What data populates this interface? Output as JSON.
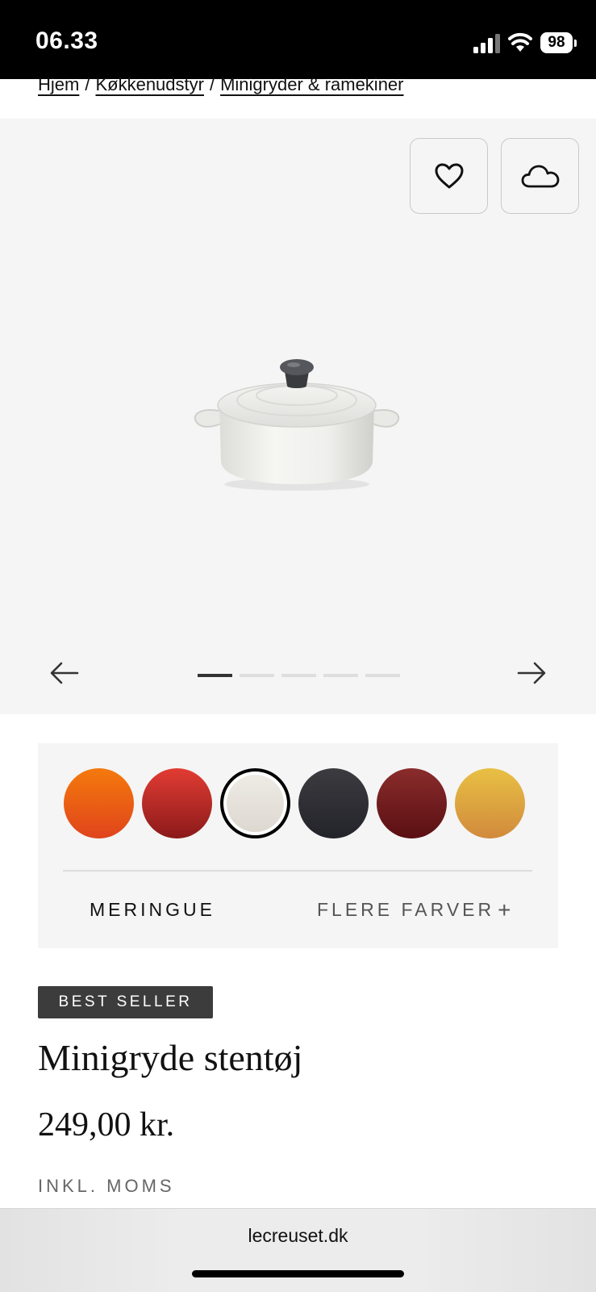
{
  "status": {
    "time": "06.33",
    "battery": "98"
  },
  "breadcrumb": {
    "items": [
      "Hjem",
      "Køkkenudstyr",
      "Minigryder & ramekiner"
    ],
    "separator": "/"
  },
  "gallery": {
    "slide_count": 5,
    "active_slide": 1
  },
  "colors": {
    "swatches": [
      {
        "name": "orange-swatch",
        "top": "#f47a0c",
        "bottom": "#e0441c"
      },
      {
        "name": "red-swatch",
        "top": "#e23c33",
        "bottom": "#8b1a1a"
      },
      {
        "name": "meringue-swatch",
        "top": "#efece6",
        "bottom": "#dcd7cf",
        "selected": true
      },
      {
        "name": "black-swatch",
        "top": "#3b3b40",
        "bottom": "#23232a"
      },
      {
        "name": "burgundy-swatch",
        "top": "#8a2c2c",
        "bottom": "#5a0f12"
      },
      {
        "name": "yellow-swatch",
        "top": "#e8c044",
        "bottom": "#d18a3c"
      }
    ],
    "selected_name": "MERINGUE",
    "more_label": "FLERE FARVER"
  },
  "product": {
    "badge": "BEST SELLER",
    "title": "Minigryde stentøj",
    "price": "249,00 kr.",
    "vat": "INKL. MOMS"
  },
  "browser": {
    "url": "lecreuset.dk"
  }
}
